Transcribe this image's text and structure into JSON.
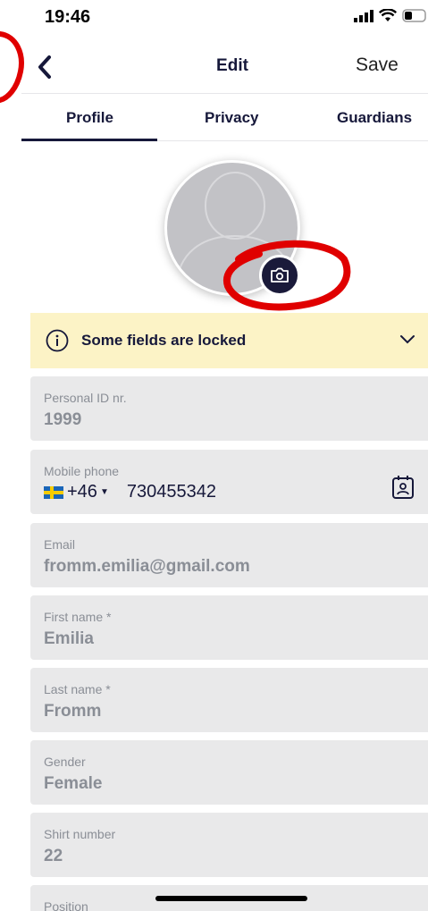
{
  "status": {
    "time": "19:46"
  },
  "nav": {
    "title": "Edit",
    "save_label": "Save"
  },
  "tabs": [
    {
      "label": "Profile",
      "active": true
    },
    {
      "label": "Privacy",
      "active": false
    },
    {
      "label": "Guardians",
      "active": false
    }
  ],
  "banner": {
    "text": "Some fields are locked"
  },
  "fields": [
    {
      "label": "Personal ID nr.",
      "value": "1999"
    },
    {
      "label": "Mobile phone",
      "country_code": "+46",
      "value": "730455342"
    },
    {
      "label": "Email",
      "value": "fromm.emilia@gmail.com"
    },
    {
      "label": "First name *",
      "value": "Emilia"
    },
    {
      "label": "Last name *",
      "value": "Fromm"
    },
    {
      "label": "Gender",
      "value": "Female"
    },
    {
      "label": "Shirt number",
      "value": "22"
    },
    {
      "label": "Position",
      "value": ""
    }
  ],
  "colors": {
    "accent": "#16183a",
    "banner_bg": "#fcf3c6",
    "field_bg": "#e9e9ea",
    "annotation_red": "#e00000"
  },
  "icons": [
    "back-chevron-icon",
    "camera-icon",
    "info-icon",
    "chevron-down-icon",
    "contact-card-icon",
    "signal-icon",
    "wifi-icon",
    "battery-icon"
  ]
}
